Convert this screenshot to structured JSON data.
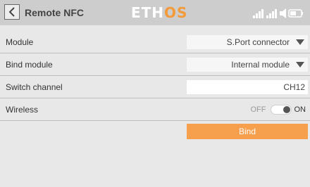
{
  "header": {
    "title": "Remote NFC",
    "logo_part1": "ETH",
    "logo_part2": "OS",
    "icons": [
      "back-arrow-icon",
      "signal-bars-icon",
      "signal-bars-icon",
      "speaker-icon",
      "battery-icon"
    ]
  },
  "rows": {
    "module": {
      "label": "Module",
      "value": "S.Port connector"
    },
    "bind_module": {
      "label": "Bind module",
      "value": "Internal module"
    },
    "switch_channel": {
      "label": "Switch channel",
      "value": "CH12"
    },
    "wireless": {
      "label": "Wireless",
      "off_label": "OFF",
      "on_label": "ON",
      "state": "on"
    }
  },
  "bind_button": {
    "label": "Bind"
  },
  "colors": {
    "accent": "#f39a3a",
    "button": "#f6a04d",
    "header": "#cdcdcd",
    "background": "#e8e8e8"
  }
}
